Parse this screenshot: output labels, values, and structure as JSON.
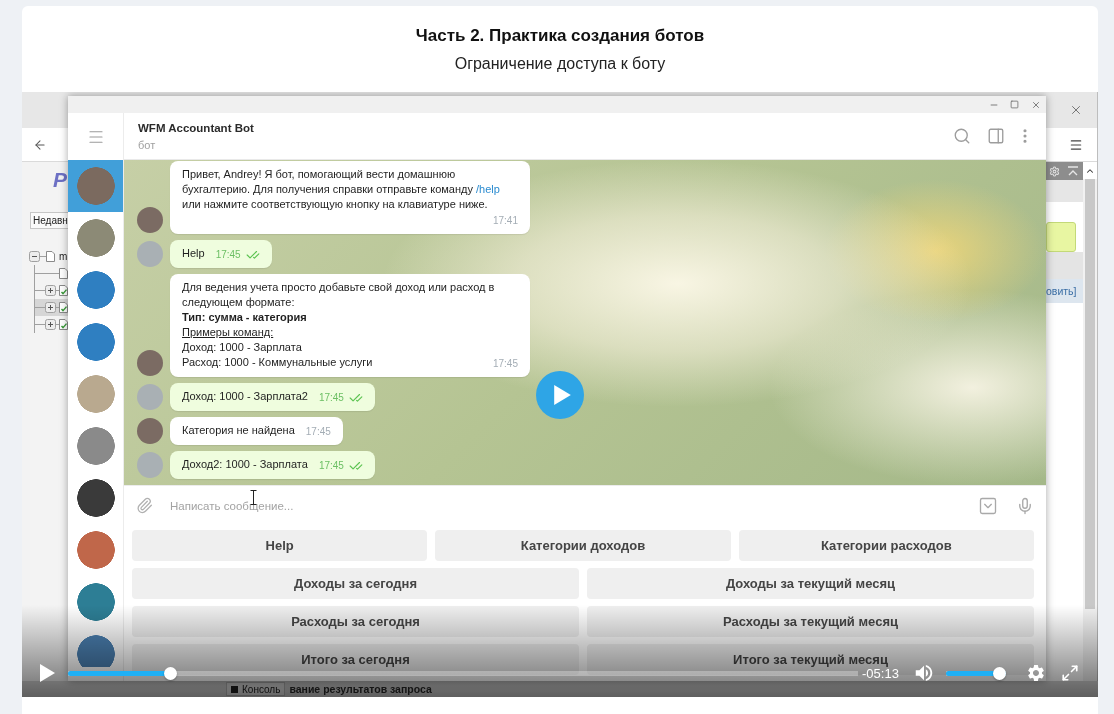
{
  "lesson": {
    "title": "Часть 2. Практика создания ботов",
    "subtitle": "Ограничение доступа к боту"
  },
  "background_app": {
    "logo": "Р",
    "dropdown": "Недавн",
    "tree": [
      {
        "label": "m",
        "expanded": true,
        "selected": false,
        "children": [
          {
            "kind": "leaf",
            "selected": false
          },
          {
            "kind": "group",
            "expanded": false,
            "selected": false
          },
          {
            "kind": "group",
            "expanded": false,
            "selected": true
          },
          {
            "kind": "group",
            "expanded": false,
            "selected": false
          }
        ]
      }
    ],
    "link_fragment": "овить]",
    "bottom_tab": "Консоль",
    "bottom_text": "вание результатов запроса"
  },
  "telegram": {
    "chat_title": "WFM Accountant Bot",
    "chat_subtitle": "бот",
    "chats": [
      {
        "selected": true
      },
      {
        "selected": false
      },
      {
        "selected": false
      },
      {
        "selected": false
      },
      {
        "selected": false
      },
      {
        "selected": false
      },
      {
        "selected": false
      },
      {
        "selected": false
      },
      {
        "selected": false
      },
      {
        "selected": false
      }
    ],
    "messages": [
      {
        "kind": "incoming",
        "lines": [
          {
            "kind": "plain",
            "segments": [
              {
                "kind": "text",
                "text": "Привет, Andrey! Я бот, помогающий вести домашнюю бухгалтерию. Для получения справки отправьте команду"
              },
              {
                "kind": "link",
                "text": "/help"
              },
              {
                "kind": "text",
                "text": "или нажмите соответствующую кнопку на клавиатуре ниже."
              }
            ]
          }
        ],
        "time": "17:41"
      },
      {
        "kind": "outgoing",
        "lines": [
          {
            "kind": "plain",
            "text": "Help"
          }
        ],
        "time": "17:45",
        "read": true
      },
      {
        "kind": "incoming",
        "lines": [
          {
            "kind": "plain",
            "text": "Для ведения учета просто добавьте свой доход или расход в следующем формате:"
          },
          {
            "kind": "bold",
            "text": "Тип: сумма - категория"
          },
          {
            "kind": "underline",
            "text": "Примеры команд:"
          },
          {
            "kind": "plain",
            "text": "Доход: 1000 - Зарплата"
          },
          {
            "kind": "plain",
            "text": "Расход: 1000 - Коммунальные услуги"
          }
        ],
        "time": "17:45"
      },
      {
        "kind": "outgoing",
        "lines": [
          {
            "kind": "plain",
            "text": "Доход: 1000 - Зарплата2"
          }
        ],
        "time": "17:45",
        "read": true
      },
      {
        "kind": "incoming",
        "lines": [
          {
            "kind": "plain",
            "text": "Категория не найдена"
          }
        ],
        "time": "17:45"
      },
      {
        "kind": "outgoing",
        "lines": [
          {
            "kind": "plain",
            "text": "Доход2: 1000 - Зарплата"
          }
        ],
        "time": "17:45",
        "read": true
      }
    ],
    "composer": {
      "placeholder": "Написать сообщение..."
    },
    "keyboard": [
      [
        "Help",
        "Категории доходов",
        "Категории расходов"
      ],
      [
        "Доходы за сегодня",
        "Доходы за текущий месяц"
      ],
      [
        "Расходы за сегодня",
        "Расходы за текущий месяц"
      ],
      [
        "Итого за сегодня",
        "Итого за текущий месяц"
      ]
    ]
  },
  "player": {
    "paused": true,
    "progress": {
      "level": 0.13
    },
    "time": "-05:13",
    "volume": {
      "level": 1
    }
  }
}
